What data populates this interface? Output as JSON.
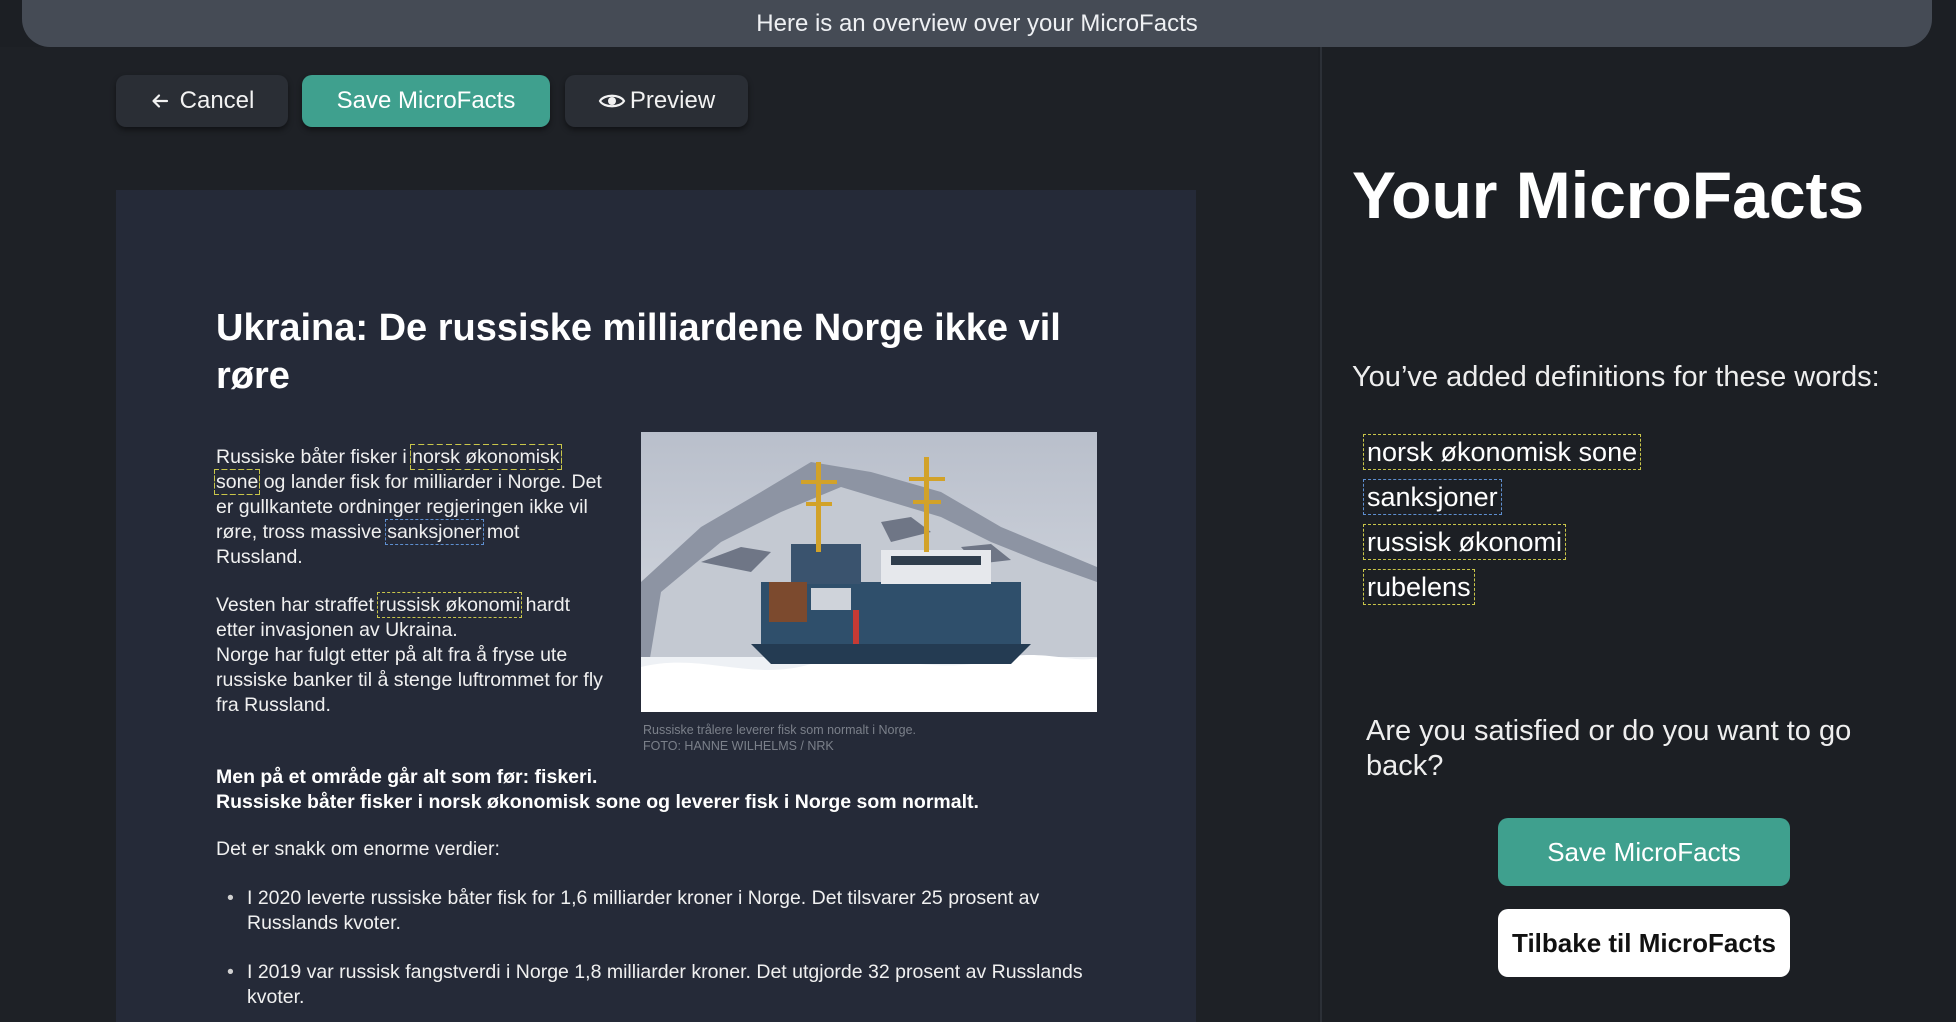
{
  "banner": {
    "text": "Here is an overview over your MicroFacts"
  },
  "toolbar": {
    "cancel_label": "Cancel",
    "save_label": "Save MicroFacts",
    "preview_label": "Preview"
  },
  "article": {
    "headline": "Ukraina: De russiske milliardene Norge ikke vil røre",
    "p1": {
      "t1": "Russiske båter fisker i ",
      "m1": "norsk økonomisk sone",
      "t2": " og lander fisk for milliarder i Norge. Det er gullkantete ordninger regjeringen ikke vil røre, tross massive ",
      "m2": "sanksjoner",
      "t3": " mot Russland."
    },
    "p2": {
      "t1": "Vesten har straffet ",
      "m1": "russisk økonomi",
      "t2": " hardt etter invasjonen av Ukraina.",
      "t3": "Norge har fulgt etter på alt fra å fryse ute russiske banker til å stenge luftrommet for fly fra Russland."
    },
    "caption_line1": "Russiske trålere leverer fisk som normalt i Norge.",
    "caption_line2": "FOTO: HANNE WILHELMS / NRK",
    "bold_line1": "Men på et område går alt som før: fiskeri.",
    "bold_line2": "Russiske båter fisker i norsk økonomisk sone og leverer fisk i Norge som normalt.",
    "plain": "Det er snakk om enorme verdier:",
    "bullets": [
      "I 2020 leverte russiske båter fisk for 1,6 milliarder kroner i Norge. Det tilsvarer 25 prosent av Russlands kvoter.",
      "I 2019 var russisk fangstverdi i Norge 1,8 milliarder kroner. Det utgjorde 32 prosent av Russlands kvoter."
    ]
  },
  "sidebar": {
    "title": "Your MicroFacts",
    "subtitle": "You’ve added definitions for these words:",
    "words": [
      "norsk økonomisk sone",
      "sanksjoner",
      "russisk økonomi",
      "rubelens"
    ],
    "question": "Are you satisfied or do you want to go back?",
    "save_label": "Save MicroFacts",
    "back_label": "Tilbake til MicroFacts"
  },
  "colors": {
    "accent": "#3fa08e",
    "highlight_yellow": "#c9c64a",
    "highlight_blue": "#5e8fd0"
  }
}
